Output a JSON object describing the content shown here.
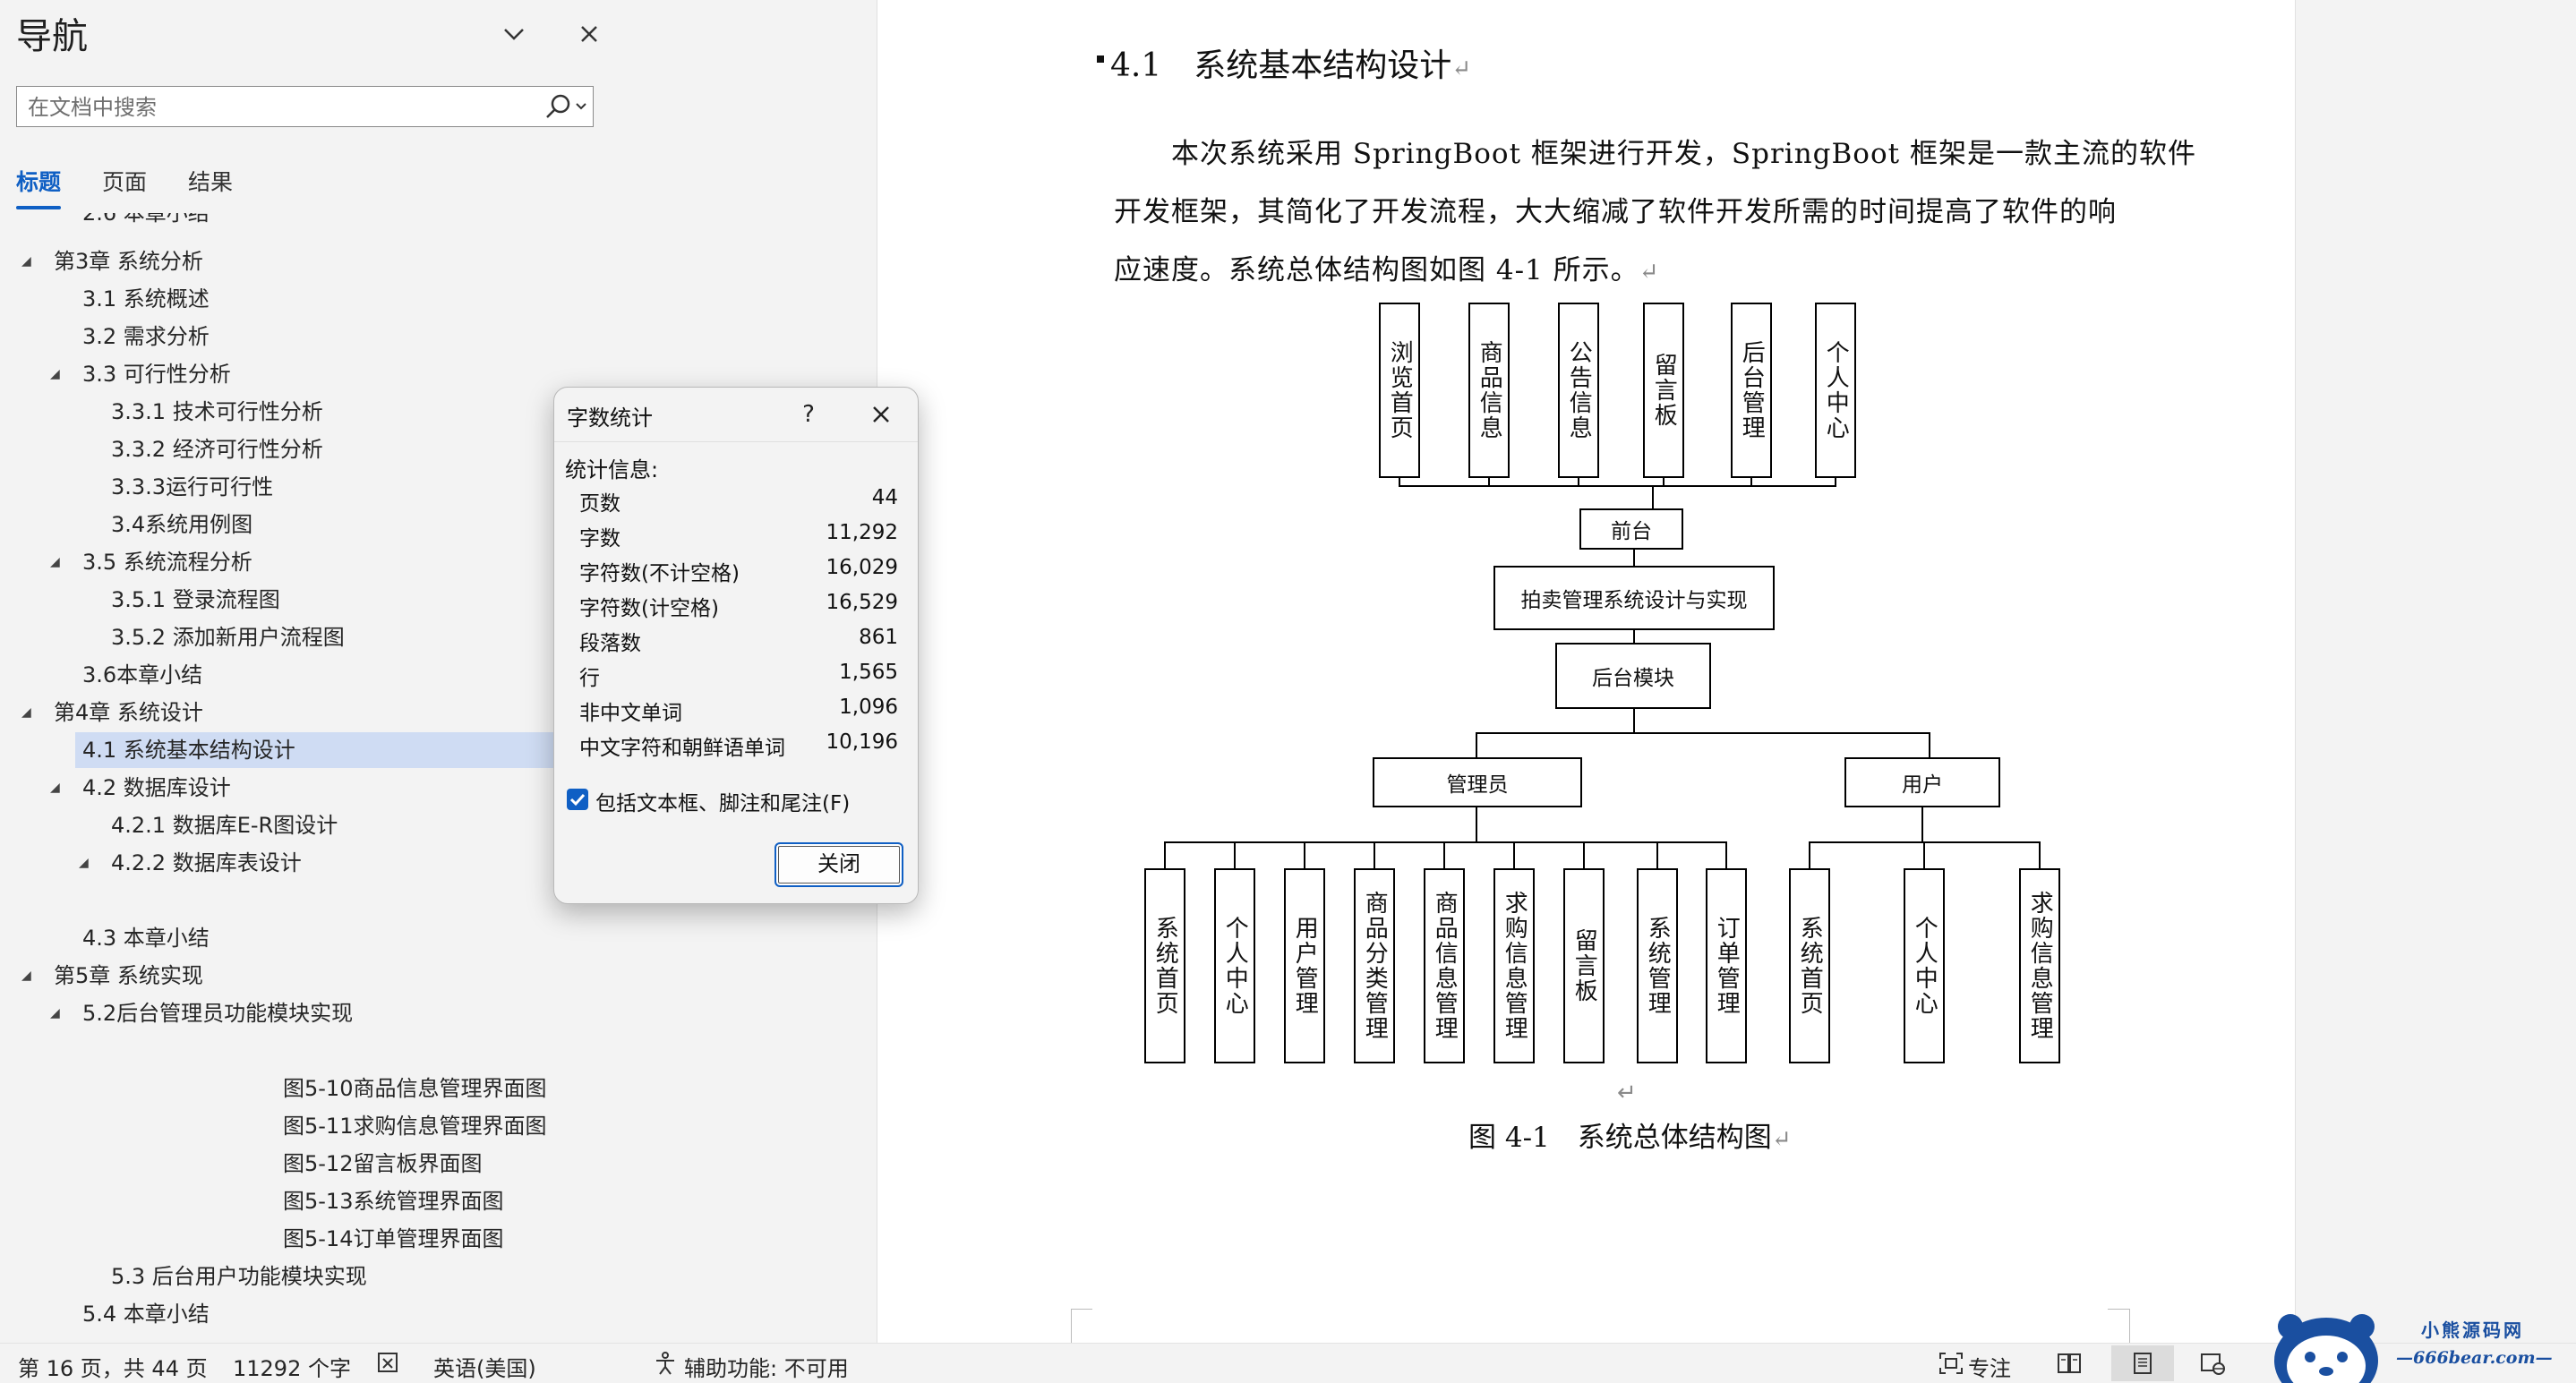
{
  "nav": {
    "title": "导航",
    "search_placeholder": "在文档中搜索",
    "tabs": [
      "标题",
      "页面",
      "结果"
    ],
    "partial_item": "2.6 本章小结",
    "items": [
      {
        "label": "第3章 系统分析",
        "level": 1,
        "expanded": true
      },
      {
        "label": "3.1 系统概述",
        "level": 2
      },
      {
        "label": "3.2 需求分析",
        "level": 2
      },
      {
        "label": "3.3 可行性分析",
        "level": 2,
        "expanded": true
      },
      {
        "label": "3.3.1 技术可行性分析",
        "level": 3
      },
      {
        "label": "3.3.2 经济可行性分析",
        "level": 3
      },
      {
        "label": "3.3.3运行可行性",
        "level": 3
      },
      {
        "label": "3.4系统用例图",
        "level": 3
      },
      {
        "label": "3.5 系统流程分析",
        "level": 2,
        "expanded": true
      },
      {
        "label": "3.5.1 登录流程图",
        "level": 3
      },
      {
        "label": "3.5.2 添加新用户流程图",
        "level": 3
      },
      {
        "label": "3.6本章小结",
        "level": 2
      },
      {
        "label": "第4章 系统设计",
        "level": 1,
        "expanded": true
      },
      {
        "label": "4.1 系统基本结构设计",
        "level": 2,
        "selected": true
      },
      {
        "label": "4.2 数据库设计",
        "level": 2,
        "expanded": true
      },
      {
        "label": "4.2.1 数据库E-R图设计",
        "level": 3
      },
      {
        "label": "4.2.2 数据库表设计",
        "level": 3,
        "expanded": true
      },
      {
        "label": "",
        "level": 3
      },
      {
        "label": "4.3 本章小结",
        "level": 2
      },
      {
        "label": "第5章 系统实现",
        "level": 1,
        "expanded": true
      },
      {
        "label": "5.2后台管理员功能模块实现",
        "level": 2,
        "expanded": true
      },
      {
        "label": "",
        "level": 3
      },
      {
        "label": "图5-10商品信息管理界面图",
        "level": 4
      },
      {
        "label": "图5-11求购信息管理界面图",
        "level": 4
      },
      {
        "label": "图5-12留言板界面图",
        "level": 4
      },
      {
        "label": "图5-13系统管理界面图",
        "level": 4
      },
      {
        "label": "图5-14订单管理界面图",
        "level": 4
      },
      {
        "label": "5.3 后台用户功能模块实现",
        "level": 3
      },
      {
        "label": "5.4 本章小结",
        "level": 2
      }
    ]
  },
  "doc": {
    "heading": "4.1　系统基本结构设计",
    "para_lines": [
      "本次系统采用 SpringBoot 框架进行开发，SpringBoot 框架是一款主流的软件",
      "开发框架，其简化了开发流程，大大缩减了软件开发所需的时间提高了软件的响",
      "应速度。系统总体结构图如图 4-1 所示。"
    ],
    "caption": "图 4-1　系统总体结构图",
    "para_mark": "↵"
  },
  "diagram": {
    "front_modules": [
      "浏览首页",
      "商品信息",
      "公告信息",
      "留言板",
      "后台管理",
      "个人中心"
    ],
    "front_label": "前台",
    "system_label": "拍卖管理系统设计与实现",
    "backend_label": "后台模块",
    "admin_label": "管理员",
    "user_label": "用户",
    "admin_modules": [
      "系统首页",
      "个人中心",
      "用户管理",
      "商品分类管理",
      "商品信息管理",
      "求购信息管理",
      "留言板",
      "系统管理",
      "订单管理"
    ],
    "user_modules": [
      "系统首页",
      "个人中心",
      "求购信息管理"
    ]
  },
  "dialog": {
    "title": "字数统计",
    "help": "?",
    "info_label": "统计信息:",
    "stats": [
      {
        "label": "页数",
        "value": "44"
      },
      {
        "label": "字数",
        "value": "11,292"
      },
      {
        "label": "字符数(不计空格)",
        "value": "16,029"
      },
      {
        "label": "字符数(计空格)",
        "value": "16,529"
      },
      {
        "label": "段落数",
        "value": "861"
      },
      {
        "label": "行",
        "value": "1,565"
      },
      {
        "label": "非中文单词",
        "value": "1,096"
      },
      {
        "label": "中文字符和朝鲜语单词",
        "value": "10,196"
      }
    ],
    "checkbox_label": "包括文本框、脚注和尾注(F)",
    "checkbox_checked": true,
    "close_label": "关闭"
  },
  "status": {
    "page": "第 16 页，共 44 页",
    "words": "11292 个字",
    "language": "英语(美国)",
    "accessibility": "辅助功能: 不可用",
    "focus": "专注"
  },
  "watermark": {
    "line1": "小熊源码网",
    "line2": "—666bear.com—"
  },
  "colors": {
    "accent": "#0f5fc4",
    "selection": "#cfdcf3"
  }
}
